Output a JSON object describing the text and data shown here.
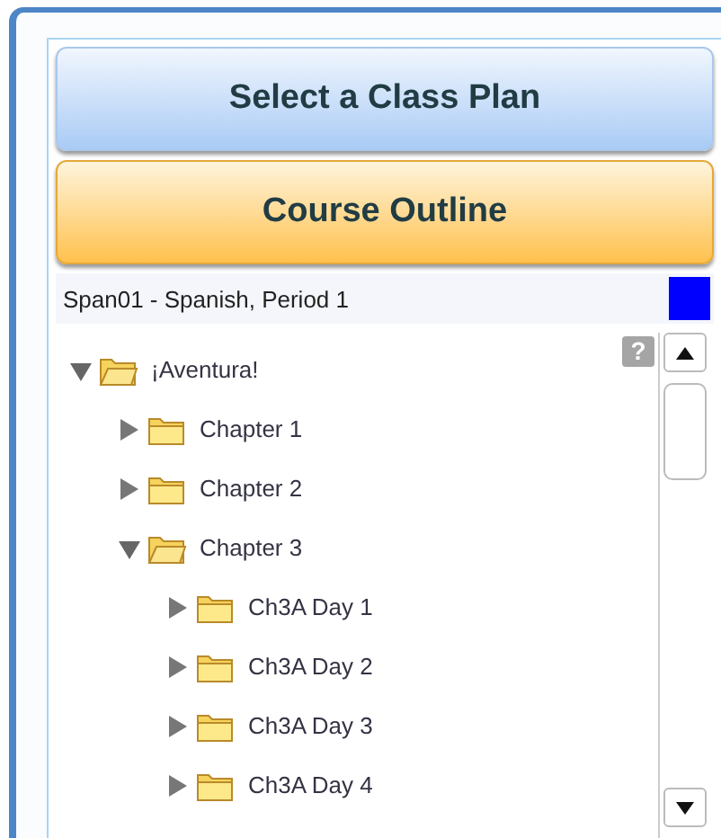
{
  "buttons": [
    {
      "label": "Select a Class Plan",
      "kind": "blue"
    },
    {
      "label": "Course Outline",
      "kind": "orange"
    }
  ],
  "class_plan": {
    "label": "Span01 - Spanish, Period 1",
    "color": "#0000ff"
  },
  "help": {
    "label": "?"
  },
  "tree": [
    {
      "label": "¡Aventura!",
      "expanded": true,
      "children": [
        {
          "label": "Chapter 1",
          "expanded": false
        },
        {
          "label": "Chapter 2",
          "expanded": false
        },
        {
          "label": "Chapter 3",
          "expanded": true,
          "children": [
            {
              "label": "Ch3A Day 1",
              "expanded": false
            },
            {
              "label": "Ch3A Day 2",
              "expanded": false
            },
            {
              "label": "Ch3A Day 3",
              "expanded": false
            },
            {
              "label": "Ch3A Day 4",
              "expanded": false
            }
          ]
        }
      ]
    }
  ]
}
